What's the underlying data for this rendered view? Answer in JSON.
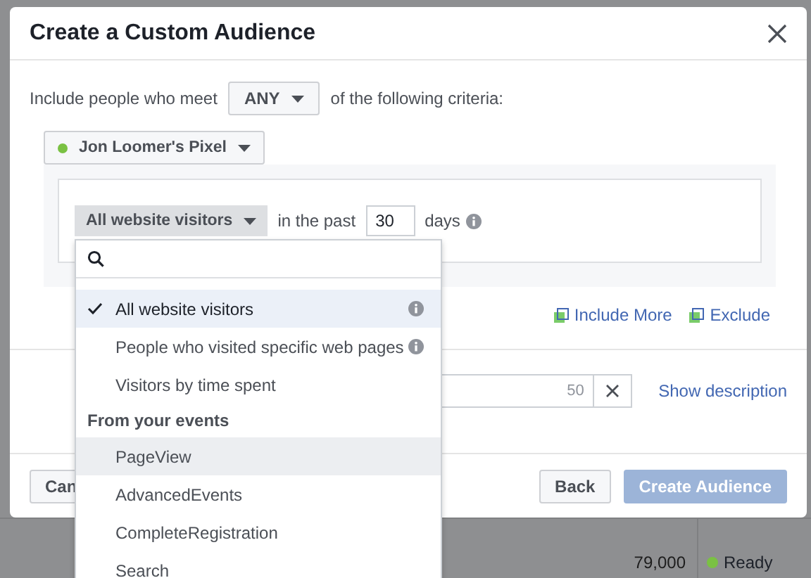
{
  "dialog": {
    "title": "Create a Custom Audience",
    "criteria": {
      "prefix": "Include people who meet",
      "match": "ANY",
      "suffix": "of the following criteria:"
    },
    "pixel": {
      "name": "Jon Loomer's Pixel"
    },
    "rule": {
      "source": "All website visitors",
      "past_label": "in the past",
      "days": "30",
      "unit": "days"
    },
    "links": [
      "Include More",
      "Exclude"
    ],
    "name_field": {
      "count": "50",
      "description_link": "Show description"
    },
    "buttons": [
      {
        "label": "Can",
        "kind": "secondary",
        "disabled": false
      },
      {
        "label": "Back",
        "kind": "secondary",
        "disabled": false
      },
      {
        "label": "Create Audience",
        "kind": "primary",
        "disabled": true
      }
    ]
  },
  "dropdown": {
    "items": [
      {
        "kind": "option",
        "label": "All website visitors",
        "selected": true,
        "hovered": false,
        "info": true
      },
      {
        "kind": "option",
        "label": "People who visited specific web pages",
        "selected": false,
        "hovered": false,
        "info": true
      },
      {
        "kind": "option",
        "label": "Visitors by time spent",
        "selected": false,
        "hovered": false,
        "info": false
      },
      {
        "kind": "header",
        "label": "From your events"
      },
      {
        "kind": "option",
        "label": "PageView",
        "selected": false,
        "hovered": true,
        "info": false
      },
      {
        "kind": "option",
        "label": "AdvancedEvents",
        "selected": false,
        "hovered": false,
        "info": false
      },
      {
        "kind": "option",
        "label": "CompleteRegistration",
        "selected": false,
        "hovered": false,
        "info": false
      },
      {
        "kind": "option",
        "label": "Search",
        "selected": false,
        "hovered": false,
        "info": false
      }
    ]
  },
  "background": {
    "audience_size": "79,000",
    "status": "Ready"
  }
}
